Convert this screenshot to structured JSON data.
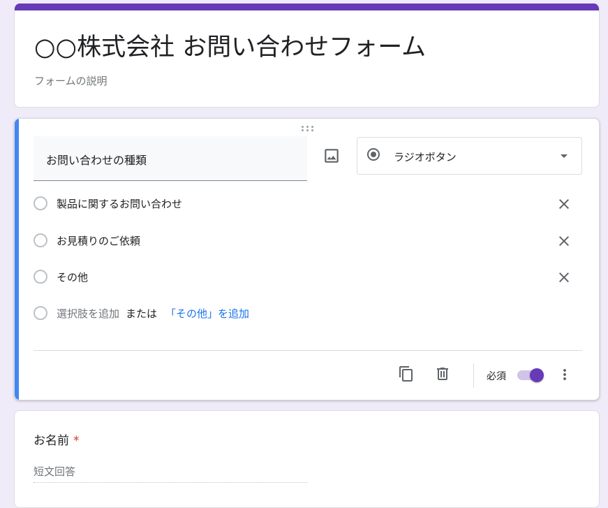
{
  "form": {
    "title": "○○株式会社 お問い合わせフォーム",
    "description": "フォームの説明"
  },
  "question": {
    "title": "お問い合わせの種類",
    "type_label": "ラジオボタン",
    "options": [
      {
        "label": "製品に関するお問い合わせ"
      },
      {
        "label": "お見積りのご依頼"
      },
      {
        "label": "その他"
      }
    ],
    "add_option_label": "選択肢を追加",
    "or_label": "または",
    "add_other_label": "「その他」を追加",
    "required_label": "必須",
    "required": true,
    "icons": {
      "image": "image-icon",
      "remove": "close-icon",
      "copy": "copy-icon",
      "delete": "trash-icon",
      "more": "more-vert-icon"
    }
  },
  "name_question": {
    "title": "お名前",
    "required_mark": "*",
    "placeholder": "短文回答"
  },
  "colors": {
    "accent": "#673ab7",
    "active_bar": "#4285f4",
    "background": "#f0ebf8",
    "link": "#1a73e8",
    "required": "#d93025"
  }
}
